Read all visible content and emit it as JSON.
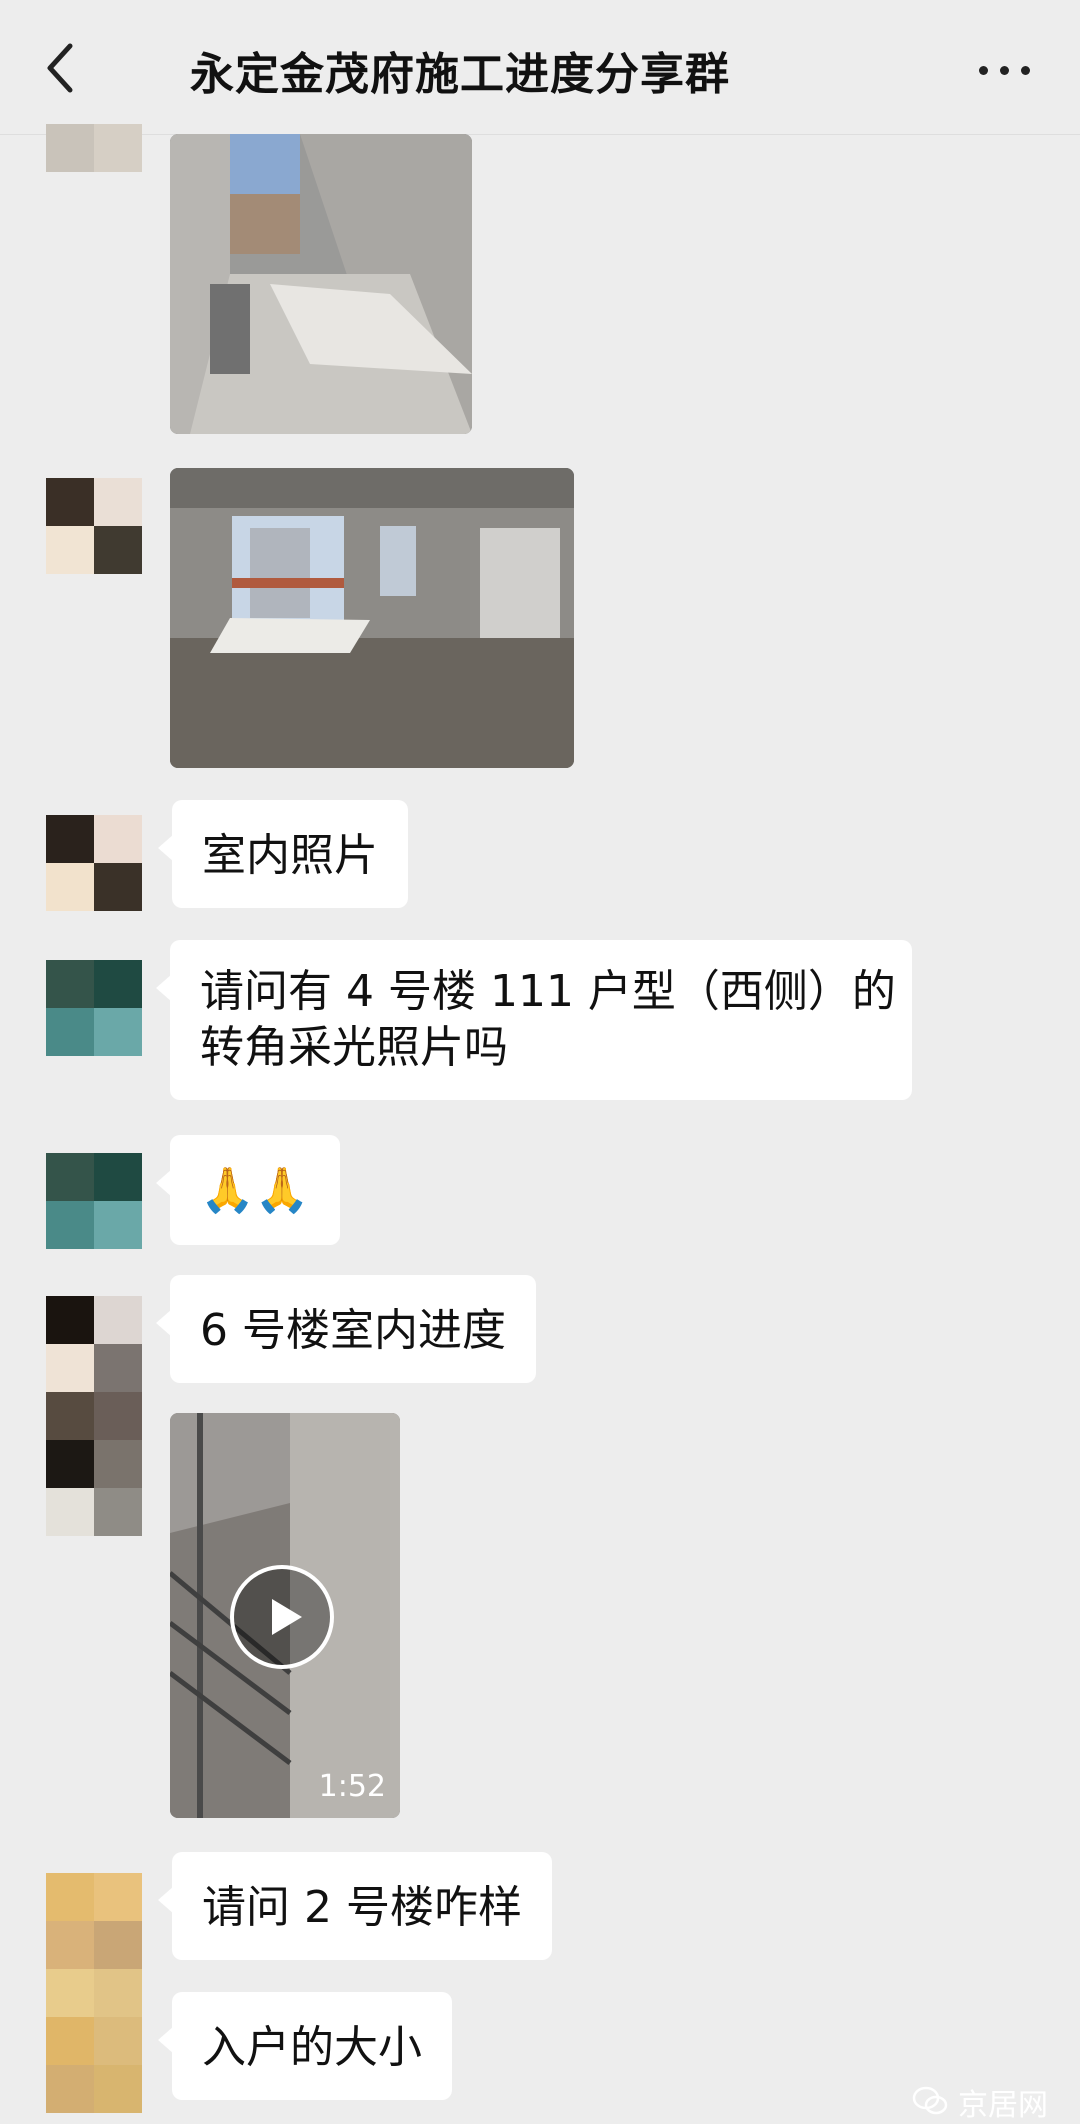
{
  "header": {
    "title": "永定金茂府施工进度分享群"
  },
  "messages": {
    "m1_text": "室内照片",
    "m2_line1": "请问有 4 号楼 111 户型（西侧）的",
    "m2_line2": "转角采光照片吗",
    "m3_text": "🙏🙏",
    "m4_text": "6 号楼室内进度",
    "video_duration": "1:52",
    "m5_text": "请问 2 号楼咋样",
    "m6_text": "入户的大小"
  },
  "watermark": {
    "text": "京居网"
  },
  "icons": {
    "back": "chevron-left-icon",
    "more": "more-dots-icon",
    "play": "play-icon",
    "watermark": "wechat-icon"
  }
}
